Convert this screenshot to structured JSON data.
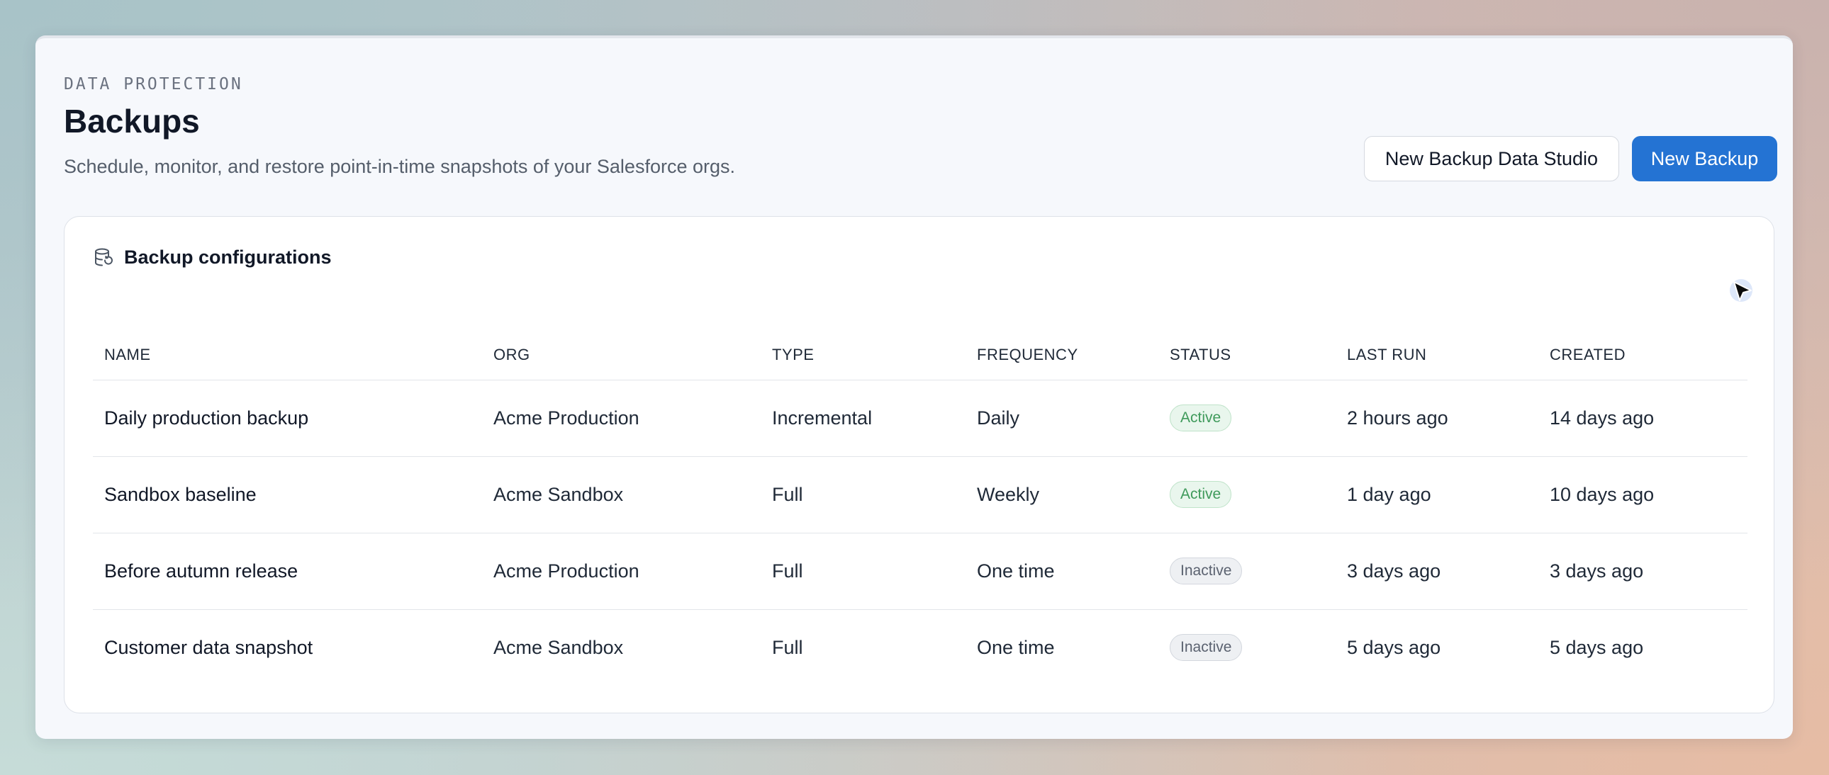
{
  "header": {
    "eyebrow": "DATA PROTECTION",
    "title": "Backups",
    "subtitle": "Schedule, monitor, and restore point-in-time snapshots of your Salesforce orgs."
  },
  "actions": {
    "secondary_label": "New Backup Data Studio",
    "primary_label": "New Backup"
  },
  "card": {
    "icon": "database-restore-icon",
    "title": "Backup configurations"
  },
  "table": {
    "columns": [
      "NAME",
      "ORG",
      "TYPE",
      "FREQUENCY",
      "STATUS",
      "LAST RUN",
      "CREATED"
    ],
    "rows": [
      {
        "name": "Daily production backup",
        "org": "Acme Production",
        "type": "Incremental",
        "frequency": "Daily",
        "status": "Active",
        "last_run": "2 hours ago",
        "created": "14 days ago"
      },
      {
        "name": "Sandbox baseline",
        "org": "Acme Sandbox",
        "type": "Full",
        "frequency": "Weekly",
        "status": "Active",
        "last_run": "1 day ago",
        "created": "10 days ago"
      },
      {
        "name": "Before autumn release",
        "org": "Acme Production",
        "type": "Full",
        "frequency": "One time",
        "status": "Inactive",
        "last_run": "3 days ago",
        "created": "3 days ago"
      },
      {
        "name": "Customer data snapshot",
        "org": "Acme Sandbox",
        "type": "Full",
        "frequency": "One time",
        "status": "Inactive",
        "last_run": "5 days ago",
        "created": "5 days ago"
      }
    ]
  },
  "colors": {
    "primary": "#2473d3",
    "active": "#3f9a5b",
    "inactive": "#5b6270"
  }
}
